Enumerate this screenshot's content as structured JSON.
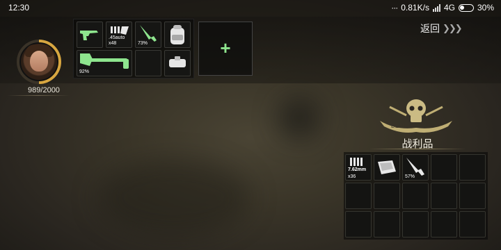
{
  "status_bar": {
    "time": "12:30",
    "speed": "0.81K/s",
    "network": "4G",
    "battery": "30%"
  },
  "player": {
    "hp_text": "989/2000",
    "hp_current": 989,
    "hp_max": 2000
  },
  "inventory": {
    "slots": [
      {
        "icon": "pistol-icon",
        "label": ""
      },
      {
        "icon": "ammo-icon",
        "label": ".45auto",
        "count": "x48"
      },
      {
        "icon": "knife-icon",
        "label": "73%"
      },
      {
        "icon": "backpack-icon",
        "label": ""
      },
      {
        "icon": "axe-icon",
        "label": "92%"
      },
      {
        "icon": "empty-slot",
        "label": ""
      },
      {
        "icon": "empty-slot",
        "label": ""
      },
      {
        "icon": "holster-icon",
        "label": ""
      }
    ],
    "add_label": "+"
  },
  "nav": {
    "back_label": "返回"
  },
  "loot": {
    "title": "战利品",
    "emblem_text": "DEAD",
    "slots": [
      {
        "icon": "ammo-icon",
        "label": "7.62mm",
        "count": "x36"
      },
      {
        "icon": "bandage-icon",
        "label": ""
      },
      {
        "icon": "knife-icon",
        "label": "57%"
      }
    ]
  },
  "colors": {
    "accent_green": "#8ee58e",
    "hp_ring": "#d8a640",
    "emblem": "#bfae74"
  }
}
